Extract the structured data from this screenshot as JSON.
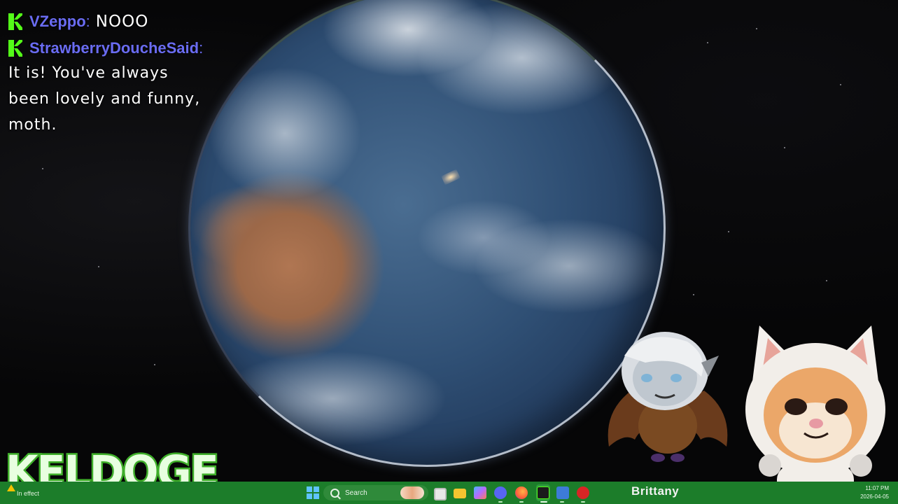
{
  "chat": {
    "messages": [
      {
        "badge_icon": "kick-badge-icon",
        "username": "VZeppo",
        "text": "NOOO"
      },
      {
        "badge_icon": "kick-badge-icon",
        "username": "StrawberryDoucheSaid",
        "text": "It is! You've always been lovely and funny, moth."
      }
    ]
  },
  "overlay": {
    "logo_text": "KELDOGE"
  },
  "taskbar": {
    "alert_text": "In effect",
    "search_placeholder": "Search",
    "user_label": "Brittany",
    "clock_time": "11:07 PM",
    "clock_date": "2026-04-05",
    "pinned_icons": [
      "start-icon",
      "search-icon",
      "task-view-icon",
      "file-explorer-icon",
      "copilot-icon",
      "discord-icon",
      "firefox-icon",
      "active-app-icon",
      "app-window-icon",
      "media-player-icon"
    ]
  },
  "colors": {
    "kick_green": "#53fc18",
    "username_color": "#6a6cf2",
    "taskbar_bg": "#1c7d2a"
  }
}
